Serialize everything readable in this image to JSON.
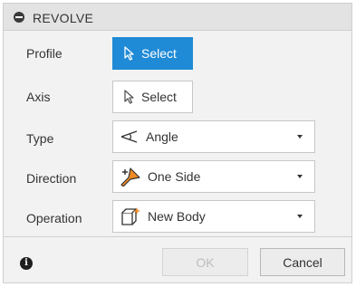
{
  "dialog": {
    "title": "REVOLVE",
    "rows": {
      "profile": {
        "label": "Profile",
        "button_label": "Select",
        "state": "active"
      },
      "axis": {
        "label": "Axis",
        "button_label": "Select",
        "state": "inactive"
      },
      "type": {
        "label": "Type",
        "value": "Angle",
        "icon": "angle-icon"
      },
      "direction": {
        "label": "Direction",
        "value": "One Side",
        "icon": "one-side-direction-icon"
      },
      "operation": {
        "label": "Operation",
        "value": "New Body",
        "icon": "new-body-icon"
      }
    },
    "footer": {
      "ok_label": "OK",
      "ok_enabled": false,
      "cancel_label": "Cancel"
    }
  },
  "colors": {
    "accent": "#1f8ad6",
    "panel_bg": "#f2f2f2",
    "header_bg": "#e3e3e3",
    "direction_icon_orange": "#f08a24"
  }
}
